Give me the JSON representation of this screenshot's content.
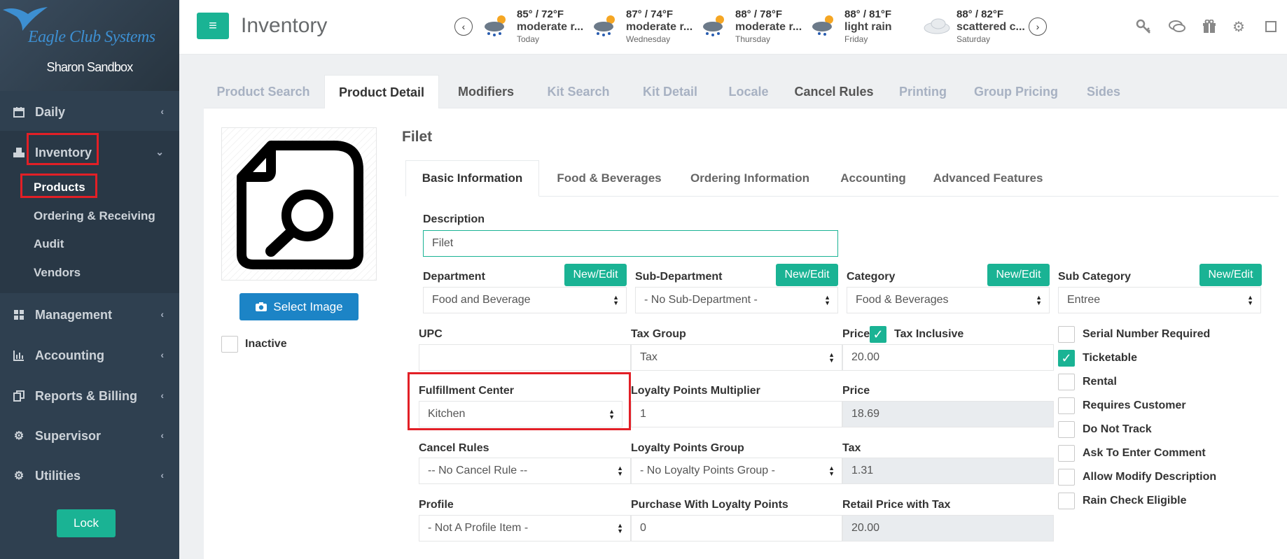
{
  "sidebar": {
    "brand": "Eagle Club Systems",
    "user": "Sharon Sandbox",
    "items": [
      {
        "label": "Daily"
      },
      {
        "label": "Inventory"
      },
      {
        "label": "Management"
      },
      {
        "label": "Accounting"
      },
      {
        "label": "Reports & Billing"
      },
      {
        "label": "Supervisor"
      },
      {
        "label": "Utilities"
      }
    ],
    "inventory_sub": [
      {
        "label": "Products"
      },
      {
        "label": "Ordering & Receiving"
      },
      {
        "label": "Audit"
      },
      {
        "label": "Vendors"
      }
    ],
    "lock_label": "Lock"
  },
  "header": {
    "title": "Inventory",
    "weather": [
      {
        "temp": "85° / 72°F",
        "cond": "moderate r...",
        "day": "Today"
      },
      {
        "temp": "87° / 74°F",
        "cond": "moderate r...",
        "day": "Wednesday"
      },
      {
        "temp": "88° / 78°F",
        "cond": "moderate r...",
        "day": "Thursday"
      },
      {
        "temp": "88° / 81°F",
        "cond": "light rain",
        "day": "Friday"
      },
      {
        "temp": "88° / 82°F",
        "cond": "scattered c...",
        "day": "Saturday"
      }
    ]
  },
  "tabs": [
    {
      "label": "Product Search"
    },
    {
      "label": "Product Detail"
    },
    {
      "label": "Modifiers"
    },
    {
      "label": "Kit Search"
    },
    {
      "label": "Kit Detail"
    },
    {
      "label": "Locale"
    },
    {
      "label": "Cancel Rules"
    },
    {
      "label": "Printing"
    },
    {
      "label": "Group Pricing"
    },
    {
      "label": "Sides"
    }
  ],
  "product": {
    "name": "Filet",
    "select_image_label": "Select Image",
    "inactive_label": "Inactive"
  },
  "subtabs": [
    {
      "label": "Basic Information"
    },
    {
      "label": "Food & Beverages"
    },
    {
      "label": "Ordering Information"
    },
    {
      "label": "Accounting"
    },
    {
      "label": "Advanced Features"
    }
  ],
  "form": {
    "description_label": "Description",
    "description_value": "Filet",
    "new_edit_label": "New/Edit",
    "department_label": "Department",
    "department_value": "Food and Beverage",
    "subdepartment_label": "Sub-Department",
    "subdepartment_value": "- No Sub-Department -",
    "category_label": "Category",
    "category_value": "Food & Beverages",
    "subcategory_label": "Sub Category",
    "subcategory_value": "Entree",
    "upc_label": "UPC",
    "upc_value": "",
    "taxgroup_label": "Tax Group",
    "taxgroup_value": "Tax",
    "price_label": "Price",
    "tax_inclusive_label": "Tax Inclusive",
    "price_value": "20.00",
    "fulfillment_label": "Fulfillment Center",
    "fulfillment_value": "Kitchen",
    "loyalty_mult_label": "Loyalty Points Multiplier",
    "loyalty_mult_value": "1",
    "price2_label": "Price",
    "price2_value": "18.69",
    "cancel_rules_label": "Cancel Rules",
    "cancel_rules_value": "-- No Cancel Rule --",
    "loyalty_group_label": "Loyalty Points Group",
    "loyalty_group_value": "- No Loyalty Points Group -",
    "tax_label": "Tax",
    "tax_value": "1.31",
    "profile_label": "Profile",
    "profile_value": "- Not A Profile Item -",
    "purchase_loyalty_label": "Purchase With Loyalty Points",
    "purchase_loyalty_value": "0",
    "retail_label": "Retail Price with Tax",
    "retail_value": "20.00",
    "options": [
      {
        "label": "Serial Number Required",
        "checked": false
      },
      {
        "label": "Ticketable",
        "checked": true
      },
      {
        "label": "Rental",
        "checked": false
      },
      {
        "label": "Requires Customer",
        "checked": false
      },
      {
        "label": "Do Not Track",
        "checked": false
      },
      {
        "label": "Ask To Enter Comment",
        "checked": false
      },
      {
        "label": "Allow Modify Description",
        "checked": false
      },
      {
        "label": "Rain Check Eligible",
        "checked": false
      }
    ]
  }
}
